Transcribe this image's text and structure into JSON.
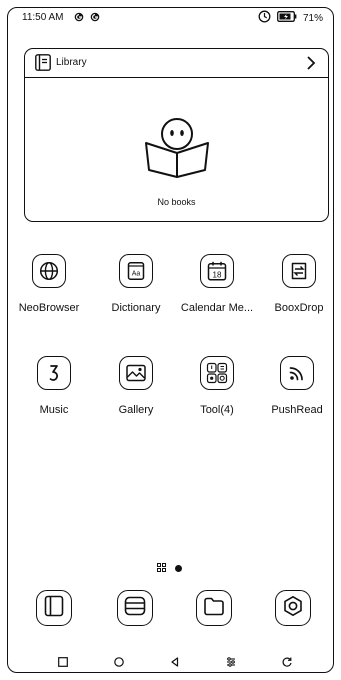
{
  "status_bar": {
    "time": "11:50 AM",
    "battery_percent": "71%"
  },
  "library": {
    "title": "Library",
    "empty_text": "No books"
  },
  "apps": [
    {
      "label": "NeoBrowser",
      "icon": "globe-icon"
    },
    {
      "label": "Dictionary",
      "icon": "dictionary-icon"
    },
    {
      "label": "Calendar Me...",
      "icon": "calendar-icon",
      "date": "18"
    },
    {
      "label": "BooxDrop",
      "icon": "transfer-icon"
    },
    {
      "label": "Music",
      "icon": "music-note-icon"
    },
    {
      "label": "Gallery",
      "icon": "gallery-icon"
    },
    {
      "label": "Tool(4)",
      "icon": "tools-folder-icon"
    },
    {
      "label": "PushRead",
      "icon": "rss-icon"
    }
  ],
  "dock": [
    "library-icon",
    "notes-icon",
    "storage-icon",
    "settings-icon"
  ],
  "nav": [
    "recent-apps-icon",
    "home-icon",
    "back-icon",
    "adjust-icon",
    "refresh-icon"
  ]
}
